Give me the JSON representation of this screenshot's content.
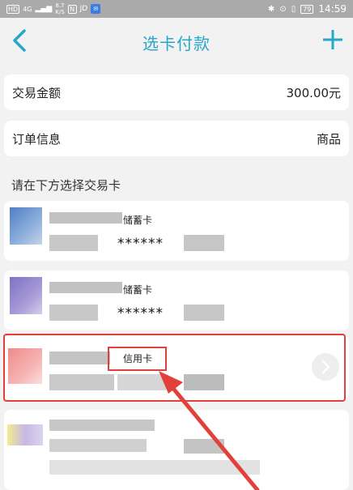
{
  "status_bar": {
    "hd_label": "HD",
    "network_label": "4G",
    "speed_value": "8.7",
    "speed_unit": "K/S",
    "battery": "79",
    "time": "14:59"
  },
  "header": {
    "title": "选卡付款",
    "back_icon": "chevron-left-icon",
    "add_icon": "plus-icon",
    "accent_color": "#26a7c9"
  },
  "transaction": {
    "amount_label": "交易金额",
    "amount_value": "300.00元",
    "order_label": "订单信息",
    "order_value": "商品"
  },
  "section_label": "请在下方选择交易卡",
  "cards": [
    {
      "type": "储蓄卡",
      "masked_number": "******"
    },
    {
      "type": "储蓄卡",
      "masked_number": "******"
    },
    {
      "type": "信用卡",
      "masked_number": ""
    },
    {
      "type": "",
      "masked_number": ""
    }
  ],
  "annotation": {
    "color": "#e2403a"
  }
}
